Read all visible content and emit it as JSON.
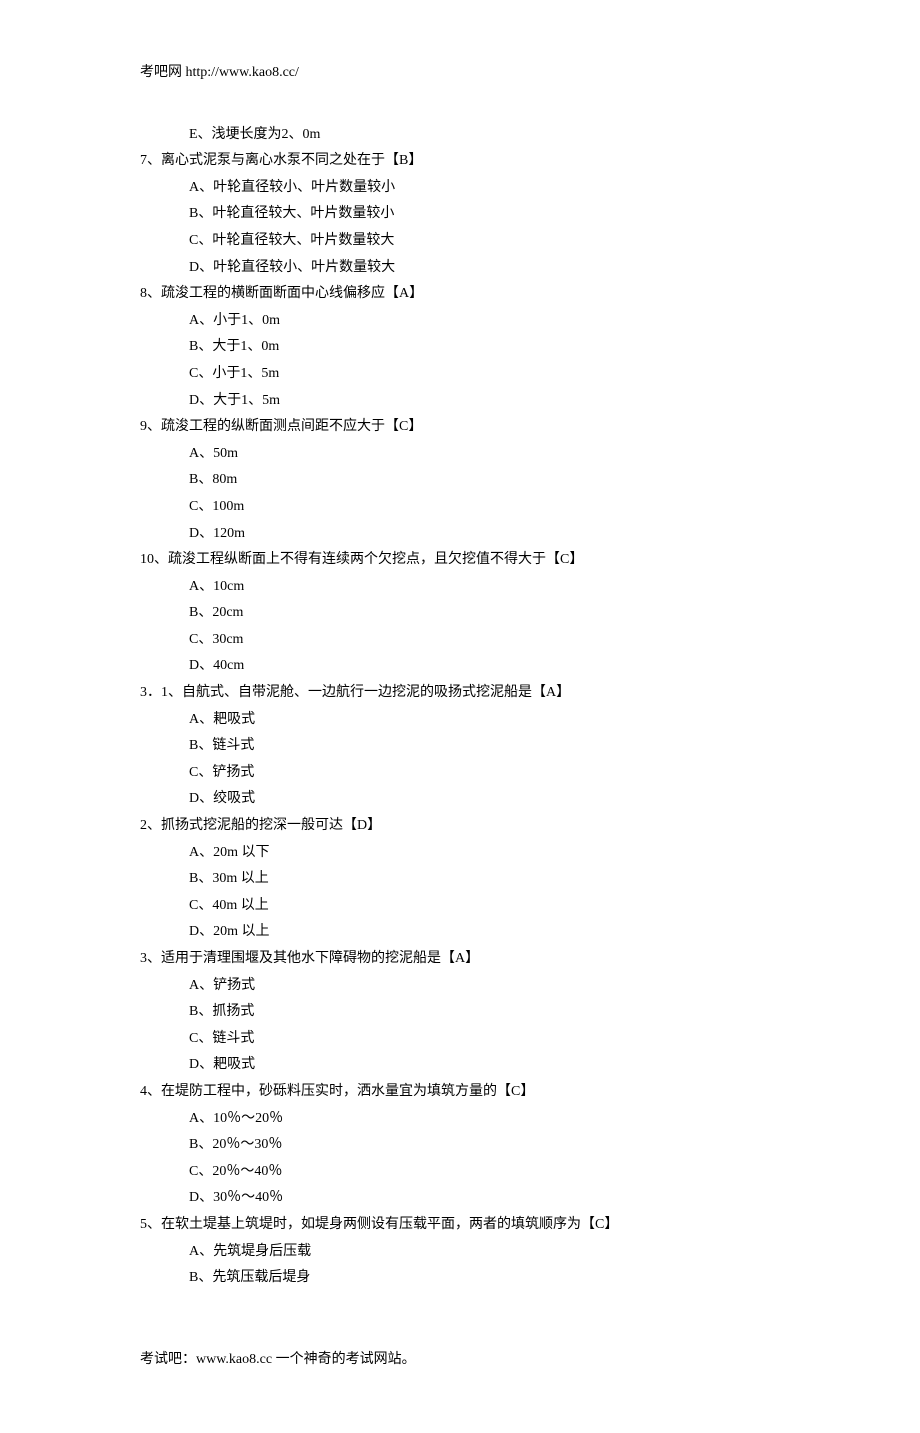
{
  "header": "考吧网 http://www.kao8.cc/",
  "footer": "考试吧：www.kao8.cc 一个神奇的考试网站。",
  "lines": [
    {
      "indent": "option",
      "text": "E、浅埂长度为2、0m"
    },
    {
      "indent": "question",
      "text": "7、离心式泥泵与离心水泵不同之处在于【B】"
    },
    {
      "indent": "option",
      "text": "A、叶轮直径较小、叶片数量较小"
    },
    {
      "indent": "option",
      "text": "B、叶轮直径较大、叶片数量较小"
    },
    {
      "indent": "option",
      "text": "C、叶轮直径较大、叶片数量较大"
    },
    {
      "indent": "option",
      "text": "D、叶轮直径较小、叶片数量较大"
    },
    {
      "indent": "question",
      "text": "8、疏浚工程的横断面断面中心线偏移应【A】"
    },
    {
      "indent": "option",
      "text": "A、小于1、0m"
    },
    {
      "indent": "option",
      "text": "B、大于1、0m"
    },
    {
      "indent": "option",
      "text": "C、小于1、5m"
    },
    {
      "indent": "option",
      "text": "D、大于1、5m"
    },
    {
      "indent": "question",
      "text": "9、疏浚工程的纵断面测点间距不应大于【C】"
    },
    {
      "indent": "option",
      "text": "A、50m"
    },
    {
      "indent": "option",
      "text": "B、80m"
    },
    {
      "indent": "option",
      "text": "C、100m"
    },
    {
      "indent": "option",
      "text": "D、120m"
    },
    {
      "indent": "question",
      "text": "10、疏浚工程纵断面上不得有连续两个欠挖点，且欠挖值不得大于【C】"
    },
    {
      "indent": "option",
      "text": "A、10cm"
    },
    {
      "indent": "option",
      "text": "B、20cm"
    },
    {
      "indent": "option",
      "text": "C、30cm"
    },
    {
      "indent": "option",
      "text": "D、40cm"
    },
    {
      "indent": "question",
      "text": "3．1、自航式、自带泥舱、一边航行一边挖泥的吸扬式挖泥船是【A】"
    },
    {
      "indent": "option",
      "text": "A、耙吸式"
    },
    {
      "indent": "option",
      "text": "B、链斗式"
    },
    {
      "indent": "option",
      "text": "C、铲扬式"
    },
    {
      "indent": "option",
      "text": "D、绞吸式"
    },
    {
      "indent": "question",
      "text": "2、抓扬式挖泥船的挖深一般可达【D】"
    },
    {
      "indent": "option",
      "text": "A、20m 以下"
    },
    {
      "indent": "option",
      "text": "B、30m 以上"
    },
    {
      "indent": "option",
      "text": "C、40m 以上"
    },
    {
      "indent": "option",
      "text": "D、20m 以上"
    },
    {
      "indent": "question",
      "text": "3、适用于清理围堰及其他水下障碍物的挖泥船是【A】"
    },
    {
      "indent": "option",
      "text": "A、铲扬式"
    },
    {
      "indent": "option",
      "text": "B、抓扬式"
    },
    {
      "indent": "option",
      "text": "C、链斗式"
    },
    {
      "indent": "option",
      "text": "D、耙吸式"
    },
    {
      "indent": "question",
      "text": "4、在堤防工程中，砂砾料压实时，洒水量宜为填筑方量的【C】"
    },
    {
      "indent": "option",
      "text": "A、10％～20％"
    },
    {
      "indent": "option",
      "text": "B、20％～30％"
    },
    {
      "indent": "option",
      "text": "C、20％～40％"
    },
    {
      "indent": "option",
      "text": "D、30％～40％"
    },
    {
      "indent": "question",
      "text": "5、在软土堤基上筑堤时，如堤身两侧设有压载平面，两者的填筑顺序为【C】"
    },
    {
      "indent": "option",
      "text": "A、先筑堤身后压载"
    },
    {
      "indent": "option",
      "text": "B、先筑压载后堤身"
    }
  ]
}
